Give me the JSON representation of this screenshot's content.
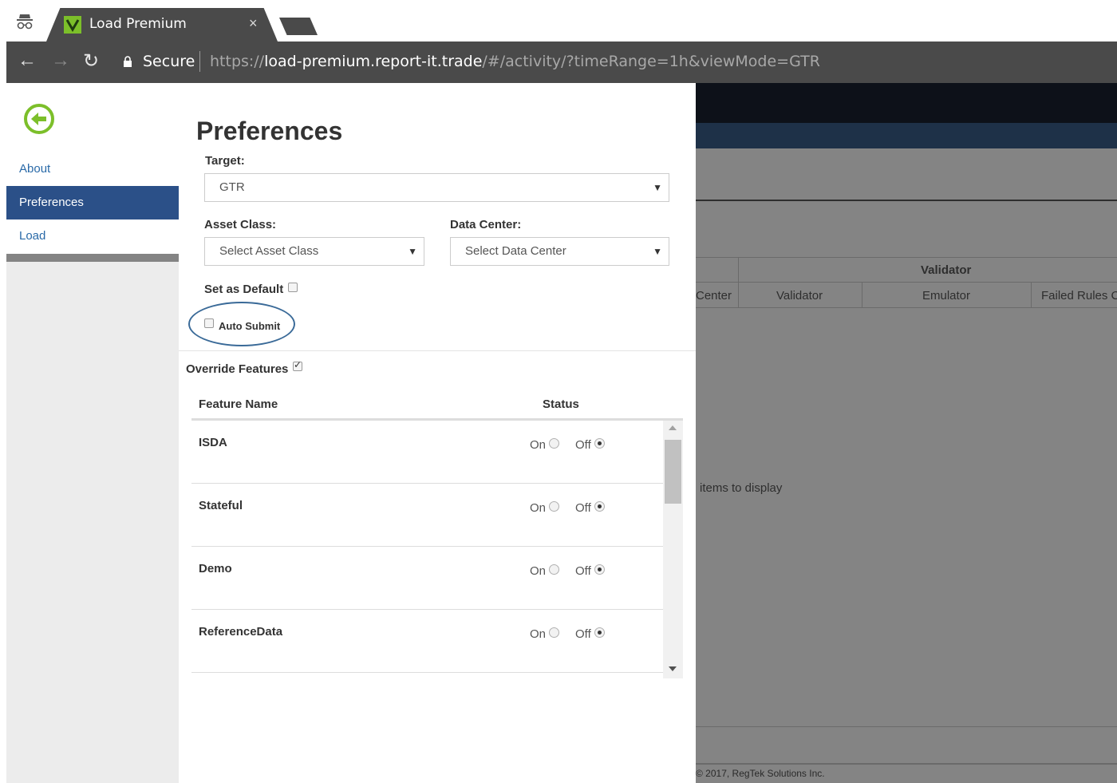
{
  "browser": {
    "tab_title": "Load Premium",
    "tab_close": "×",
    "secure_label": "Secure",
    "url_scheme": "https://",
    "url_host": "load-premium.report-it.trade",
    "url_path": "/#/activity/?timeRange=1h&viewMode=GTR"
  },
  "sidebar": {
    "items": [
      {
        "label": "About"
      },
      {
        "label": "Preferences"
      },
      {
        "label": "Load"
      }
    ]
  },
  "panel": {
    "title": "Preferences",
    "target_label": "Target:",
    "target_value": "GTR",
    "asset_class_label": "Asset Class:",
    "asset_class_value": "Select Asset Class",
    "data_center_label": "Data Center:",
    "data_center_value": "Select Data Center",
    "set_default_label": "Set as Default",
    "auto_submit_label": "Auto Submit",
    "override_label": "Override Features",
    "col_feature": "Feature Name",
    "col_status": "Status",
    "on_label": "On",
    "off_label": "Off",
    "features": [
      {
        "name": "ISDA",
        "status": "Off"
      },
      {
        "name": "Stateful",
        "status": "Off"
      },
      {
        "name": "Demo",
        "status": "Off"
      },
      {
        "name": "ReferenceData",
        "status": "Off"
      }
    ]
  },
  "background": {
    "group_header": "Validator",
    "col_center": "Center",
    "col_validator": "Validator",
    "col_emulator": "Emulator",
    "col_failed": "Failed Rules C",
    "empty_text": "items to display",
    "copyright": "© 2017, RegTek Solutions Inc."
  },
  "colors": {
    "accent_green": "#7cbf2a",
    "nav_active": "#2b5088",
    "link": "#2a6aa8",
    "highlight_ellipse": "#3a6a98"
  }
}
